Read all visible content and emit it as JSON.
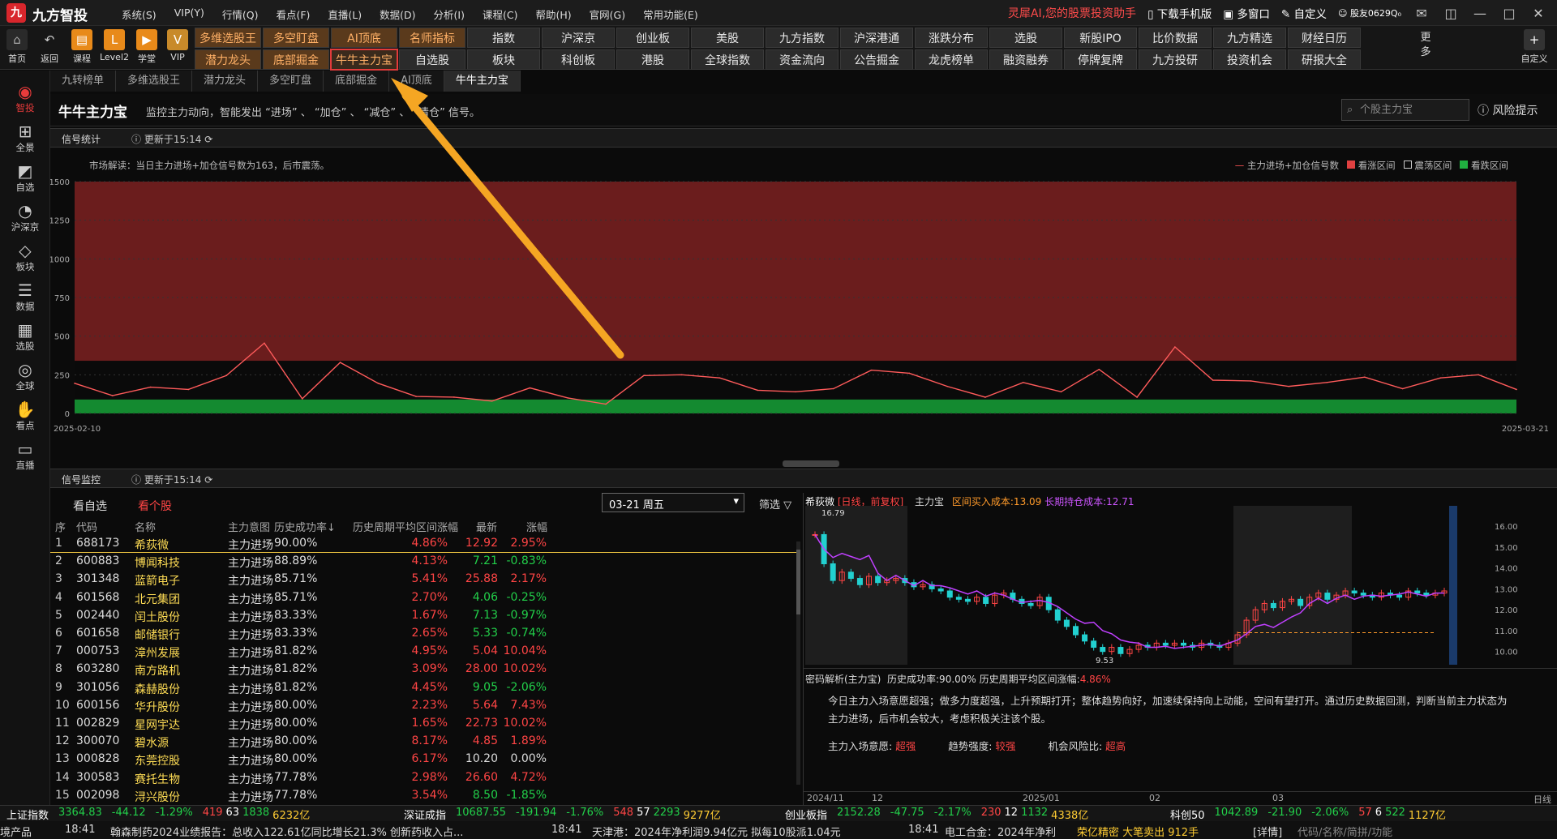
{
  "app": {
    "name": "九方智投",
    "slogan": "灵犀AI,您的股票投资助手",
    "download": "下载手机版",
    "multiwin": "多窗口",
    "custom": "自定义",
    "user": "股友0629Q₀"
  },
  "menus": [
    "系统(S)",
    "VIP(Y)",
    "行情(Q)",
    "看点(F)",
    "直播(L)",
    "数据(D)",
    "分析(I)",
    "课程(C)",
    "帮助(H)",
    "官网(G)",
    "常用功能(E)"
  ],
  "toolbar": {
    "home": "首页",
    "back": "返回",
    "course": "课程",
    "level2": "Level2",
    "study": "学堂",
    "vip": "VIP",
    "grid": [
      [
        "多维选股王",
        "潜力龙头"
      ],
      [
        "多空盯盘",
        "底部掘金"
      ],
      [
        "AI顶底",
        "牛牛主力宝"
      ],
      [
        "名师指标",
        "自选股"
      ],
      [
        "指数",
        "板块"
      ],
      [
        "沪深京",
        "科创板"
      ],
      [
        "创业板",
        "港股"
      ],
      [
        "美股",
        "全球指数"
      ],
      [
        "九方指数",
        "资金流向"
      ],
      [
        "沪深港通",
        "公告掘金"
      ],
      [
        "涨跌分布",
        "龙虎榜单"
      ],
      [
        "选股",
        "融资融券"
      ],
      [
        "新股IPO",
        "停牌复牌"
      ],
      [
        "比价数据",
        "九方投研"
      ],
      [
        "九方精选",
        "投资机会"
      ],
      [
        "财经日历",
        "研报大全"
      ]
    ],
    "more": "更多",
    "customize": "自定义"
  },
  "subtabs": [
    "九转榜单",
    "多维选股王",
    "潜力龙头",
    "多空盯盘",
    "底部掘金",
    "AI顶底",
    "牛牛主力宝"
  ],
  "sidebar": [
    "智投",
    "全景",
    "自选",
    "沪深京",
    "板块",
    "数据",
    "选股",
    "全球",
    "看点",
    "直播"
  ],
  "page": {
    "title": "牛牛主力宝",
    "desc": "监控主力动向，智能发出 “进场” 、 “加仓” 、 “减仓” 、 “清仓” 信号。",
    "search_placeholder": "个股主力宝",
    "risk": "风险提示"
  },
  "signal_stats": {
    "label": "信号统计",
    "updated": "更新于15:14",
    "note": "市场解读：当日主力进场+加仓信号数为163，后市震荡。",
    "legend": [
      "主力进场+加仓信号数",
      "看涨区间",
      "震荡区间",
      "看跌区间"
    ]
  },
  "chart_data": {
    "type": "line",
    "x_start": "2025-02-10",
    "x_end": "2025-03-21",
    "ylim": [
      0,
      1500
    ],
    "yticks": [
      0,
      250,
      500,
      750,
      1000,
      1250,
      1500
    ],
    "values": [
      195,
      115,
      170,
      155,
      245,
      455,
      95,
      330,
      195,
      110,
      105,
      80,
      165,
      100,
      60,
      245,
      250,
      230,
      150,
      140,
      160,
      280,
      260,
      175,
      105,
      200,
      140,
      285,
      105,
      430,
      215,
      210,
      175,
      200,
      235,
      160,
      230,
      250,
      155
    ],
    "bands": {
      "bull": [
        340,
        1500
      ],
      "neutral": [
        90,
        340
      ],
      "bear": [
        0,
        90
      ]
    }
  },
  "monitor": {
    "label": "信号监控",
    "updated": "更新于15:14",
    "tab_watch": "看自选",
    "tab_all": "看个股",
    "date": "03-21 周五",
    "filter": "筛选",
    "headers": [
      "序",
      "代码",
      "名称",
      "主力意图",
      "历史成功率↓",
      "历史周期平均区间涨幅",
      "最新",
      "涨幅"
    ],
    "rows": [
      [
        "1",
        "688173",
        "希荻微",
        "主力进场",
        "90.00%",
        "4.86%",
        "12.92",
        "2.95%"
      ],
      [
        "2",
        "600883",
        "博闻科技",
        "主力进场",
        "88.89%",
        "4.13%",
        "7.21",
        "-0.83%"
      ],
      [
        "3",
        "301348",
        "蓝箭电子",
        "主力进场",
        "85.71%",
        "5.41%",
        "25.88",
        "2.17%"
      ],
      [
        "4",
        "601568",
        "北元集团",
        "主力进场",
        "85.71%",
        "2.70%",
        "4.06",
        "-0.25%"
      ],
      [
        "5",
        "002440",
        "闰土股份",
        "主力进场",
        "83.33%",
        "1.67%",
        "7.13",
        "-0.97%"
      ],
      [
        "6",
        "601658",
        "邮储银行",
        "主力进场",
        "83.33%",
        "2.65%",
        "5.33",
        "-0.74%"
      ],
      [
        "7",
        "000753",
        "漳州发展",
        "主力进场",
        "81.82%",
        "4.95%",
        "5.04",
        "10.04%"
      ],
      [
        "8",
        "603280",
        "南方路机",
        "主力进场",
        "81.82%",
        "3.09%",
        "28.00",
        "10.02%"
      ],
      [
        "9",
        "301056",
        "森赫股份",
        "主力进场",
        "81.82%",
        "4.45%",
        "9.05",
        "-2.06%"
      ],
      [
        "10",
        "600156",
        "华升股份",
        "主力进场",
        "80.00%",
        "2.23%",
        "5.64",
        "7.43%"
      ],
      [
        "11",
        "002829",
        "星网宇达",
        "主力进场",
        "80.00%",
        "1.65%",
        "22.73",
        "10.02%"
      ],
      [
        "12",
        "300070",
        "碧水源",
        "主力进场",
        "80.00%",
        "8.17%",
        "4.85",
        "1.89%"
      ],
      [
        "13",
        "000828",
        "东莞控股",
        "主力进场",
        "80.00%",
        "6.17%",
        "10.20",
        "0.00%"
      ],
      [
        "14",
        "300583",
        "赛托生物",
        "主力进场",
        "77.78%",
        "2.98%",
        "26.60",
        "4.72%"
      ],
      [
        "15",
        "002098",
        "浔兴股份",
        "主力进场",
        "77.78%",
        "3.54%",
        "8.50",
        "-1.85%"
      ]
    ]
  },
  "kline": {
    "name": "希荻微",
    "period": "[日线，前复权]",
    "tool": "主力宝",
    "cost": "区间买入成本:13.09",
    "longcost": "长期持仓成本:12.71",
    "high": "16.79",
    "low": "9.53",
    "yticks": [
      "16.00",
      "15.00",
      "14.00",
      "13.00",
      "12.00",
      "11.00",
      "10.00"
    ],
    "xticks": [
      "2024/11",
      "12",
      "2025/01",
      "02",
      "03"
    ],
    "daily": "日线",
    "analysis_title": "密码解析(主力宝)",
    "success": "历史成功率:90.00%",
    "avg": "历史周期平均区间涨幅:",
    "avg_val": "4.86%",
    "text": "今日主力入场意愿超强；做多力度超强，上升预期打开；整体趋势向好，加速续保持向上动能，空间有望打开。通过历史数据回测，判断当前主力状态为主力进场，后市机会较大，考虑积极关注该个股。",
    "will_l": "主力入场意愿:",
    "will": "超强",
    "trend_l": "趋势强度:",
    "trend": "较强",
    "risk_l": "机会风险比:",
    "risk": "超高"
  },
  "status": [
    [
      "上证指数",
      "3364.83",
      "-44.12",
      "-1.29%",
      "419",
      "63",
      "1838",
      "6232亿"
    ],
    [
      "深证成指",
      "10687.55",
      "-191.94",
      "-1.76%",
      "548",
      "57",
      "2293",
      "9277亿"
    ],
    [
      "创业板指",
      "2152.28",
      "-47.75",
      "-2.17%",
      "230",
      "12",
      "1132",
      "4338亿"
    ],
    [
      "科创50",
      "1042.89",
      "-21.90",
      "-2.06%",
      "57",
      "6",
      "522",
      "1127亿"
    ]
  ],
  "ticker": [
    "境产品",
    "18:41",
    "翰森制药2024业绩报告：总收入122.61亿同比增长21.3%  创新药收入占...",
    "18:41",
    "天津港：2024年净利润9.94亿元  拟每10股派1.04元",
    "18:41",
    "电工合金：2024年净利",
    "荣亿精密 大笔卖出 912手",
    "[详情]",
    "代码/名称/简拼/功能"
  ]
}
